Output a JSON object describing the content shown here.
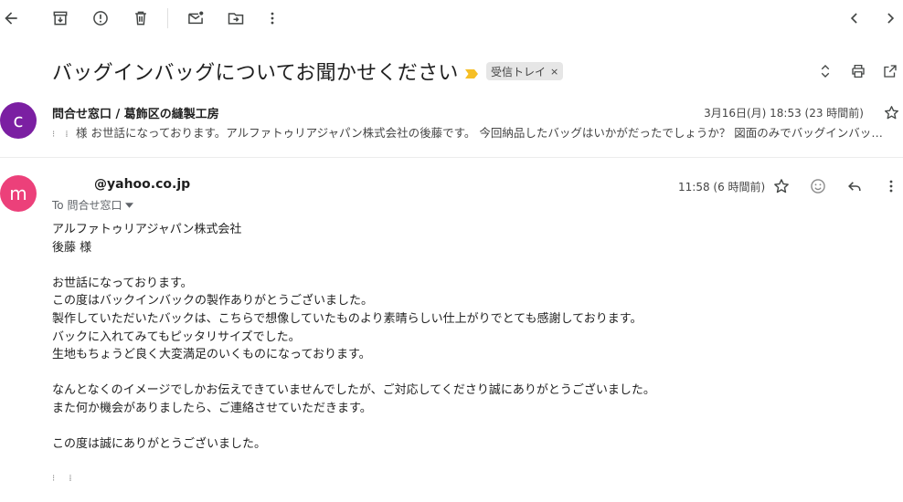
{
  "toolbar": {
    "back": "back-arrow-icon",
    "archive": "archive-icon",
    "spam": "report-spam-icon",
    "delete": "trash-icon",
    "mark_unread": "mark-unread-icon",
    "move": "move-to-icon",
    "more": "more-vert-icon",
    "prev": "chevron-left-icon",
    "next": "chevron-right-icon"
  },
  "subject": {
    "title": "バッグインバッグについてお聞かせください",
    "label": "受信トレイ",
    "label_close": "×"
  },
  "thread": [
    {
      "avatar_letter": "c",
      "avatar_color": "#7b1fa2",
      "sender": "問合せ窓口 / 葛飾区の縫製工房",
      "date": "3月16日(月) 18:53 (23 時間前)",
      "snippet_marks": "⁝ ⁞",
      "snippet": "様 お世話になっております。アルファトゥリアジャパン株式会社の後藤です。 今回納品したバッグはいかがだったでしょうか？ 図面のみでバッグインバッグをお作りしましたので、何かご不明点やご要望がありましたらお知らせください。"
    },
    {
      "avatar_letter": "m",
      "avatar_color": "#ec407a",
      "sender_domain": "@yahoo.co.jp",
      "to_label": "To 問合せ窓口",
      "date": "11:58 (6 時間前)",
      "body": {
        "company": "アルファトゥリアジャパン株式会社",
        "recipient": "後藤 様",
        "line1": "お世話になっております。",
        "line2": "この度はバックインバックの製作ありがとうございました。",
        "line3": "製作していただいたバックは、こちらで想像していたものより素晴らしい仕上がりでとても感謝しております。",
        "line4": "バックに入れてみてもピッタリサイズでした。",
        "line5": "生地もちょうど良く大変満足のいくものになっております。",
        "line6": "なんとなくのイメージでしかお伝えできていませんでしたが、ご対応してくださり誠にありがとうございました。",
        "line7": "また何か機会がありましたら、ご連絡させていただきます。",
        "line8": "この度は誠にありがとうございました。",
        "signature_marks": "⁝ ⁞"
      }
    }
  ],
  "colors": {
    "accent": "#1a73e8",
    "icon": "#444746",
    "importance": "#f6bf26"
  }
}
